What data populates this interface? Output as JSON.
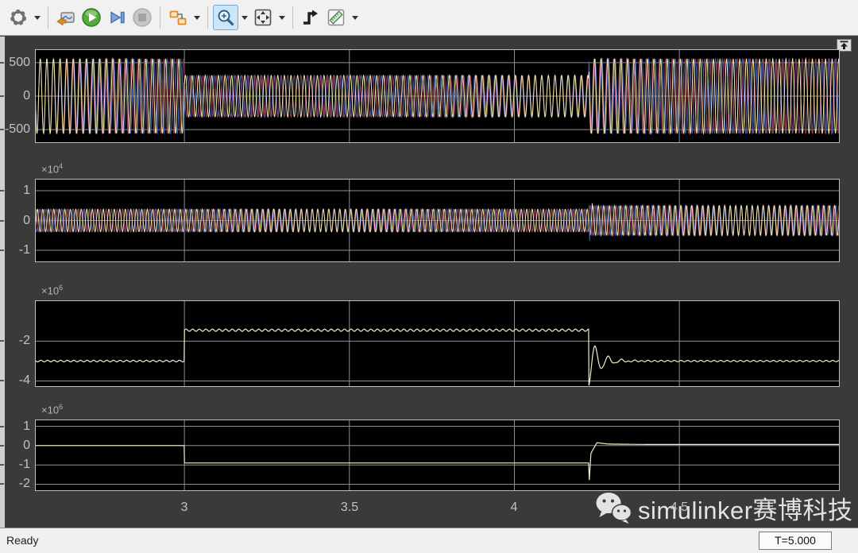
{
  "toolbar": {
    "icons": [
      "settings-gear",
      "highlight-simulink-block",
      "run",
      "step-forward",
      "stop",
      "simulink-block-diagram",
      "zoom",
      "fit-to-view",
      "trigger",
      "measurements"
    ],
    "zoom_tool_active": true
  },
  "statusbar": {
    "status": "Ready",
    "time": "T=5.000"
  },
  "watermark": {
    "icon": "wechat-icon",
    "text": "simulinker赛博科技"
  },
  "colors": {
    "figure_bg": "#3a3a3a",
    "plot_bg": "#000000",
    "grid": "#8f8f8f",
    "axis_border": "#bdbdbd",
    "tick_label": "#c3c3c3",
    "toolbar_bg": "#f1f1f1",
    "zoom_active_bg": "#cde6f7",
    "signal_yellow": "#eee8a8",
    "signal_red": "#8e3a52",
    "signal_blue": "#3f5fae",
    "signal_mono": "#f2eec9"
  },
  "chart_data": {
    "type": "line",
    "title": "",
    "xlabel": "",
    "legend": false,
    "grid": true,
    "x": {
      "lim": [
        2.547,
        4.986
      ],
      "ticks": [
        3,
        3.5,
        4,
        4.5
      ],
      "tick_labels": [
        "3",
        "3.5",
        "4",
        "4.5"
      ]
    },
    "plots": [
      {
        "name": "three-phase-signal-1",
        "exp": null,
        "yticks": [
          500,
          0,
          -500
        ],
        "ylim": [
          -700,
          700
        ],
        "signal": {
          "kind": "three-phase-sine",
          "freq_hz": 50,
          "phase_offset": 0.6,
          "colors": [
            "#eee8a8",
            "#8e3a52",
            "#3f5fae"
          ],
          "amplitude_segments": [
            {
              "from": 2.547,
              "to": 3.0,
              "amp": 560
            },
            {
              "from": 3.0,
              "to": 4.225,
              "amp": 310
            },
            {
              "from": 4.225,
              "to": 4.986,
              "amp": 560
            }
          ]
        }
      },
      {
        "name": "three-phase-signal-2",
        "exp": 4,
        "yticks": [
          10000,
          0,
          -10000
        ],
        "ylim": [
          -14000,
          14000
        ],
        "signal": {
          "kind": "three-phase-sine",
          "freq_hz": 60,
          "phase_offset": 0.0,
          "colors": [
            "#eee8a8",
            "#8e3a52",
            "#3f5fae"
          ],
          "amplitude_segments": [
            {
              "from": 2.547,
              "to": 4.225,
              "amp": 3800
            },
            {
              "from": 4.225,
              "to": 4.986,
              "amp": 5000
            }
          ],
          "events": [
            {
              "t": 4.228,
              "from": -3800,
              "to": -6800,
              "color": "#3f5fae"
            },
            {
              "t": 4.236,
              "from": 3800,
              "to": 5800,
              "color": "#eee8a8"
            }
          ]
        }
      },
      {
        "name": "step-signal-with-ringing",
        "exp": 6,
        "yticks": [
          -2000000,
          -4000000
        ],
        "ylim": [
          -4300000,
          50000
        ],
        "signal": {
          "kind": "piecewise",
          "color": "#f2eec9",
          "segments": [
            {
              "from": 2.547,
              "to": 3.0,
              "level": -3000000,
              "ripple_amp": 40000,
              "ripple_freq_hz": 50
            },
            {
              "from": 3.0,
              "to": 4.225,
              "level": -1450000,
              "ripple_amp": 55000,
              "ripple_freq_hz": 50
            }
          ],
          "transient": {
            "t": 4.225,
            "spike_to": -4300000,
            "settle_level": -3000000,
            "ring_freq_hz": 25,
            "ring_decay": 30,
            "settle_ripple_amp": 35000,
            "settle_ripple_freq_hz": 50
          }
        }
      },
      {
        "name": "step-signal",
        "exp": 6,
        "yticks": [
          1000000,
          0,
          -1000000,
          -2000000
        ],
        "ylim": [
          -2350000,
          1350000
        ],
        "signal": {
          "kind": "piecewise",
          "color": "#f2eec9",
          "segments": [
            {
              "from": 2.547,
              "to": 3.0,
              "level": 0,
              "ripple_amp": 0,
              "ripple_freq_hz": 0
            },
            {
              "from": 3.0,
              "to": 4.225,
              "level": -900000,
              "ripple_amp": 0,
              "ripple_freq_hz": 0
            }
          ],
          "transient_points": [
            [
              4.225,
              -900000
            ],
            [
              4.227,
              -1850000
            ],
            [
              4.232,
              -400000
            ],
            [
              4.25,
              150000
            ],
            [
              4.285,
              80000
            ],
            [
              4.4,
              60000
            ],
            [
              4.986,
              60000
            ]
          ]
        }
      }
    ]
  }
}
